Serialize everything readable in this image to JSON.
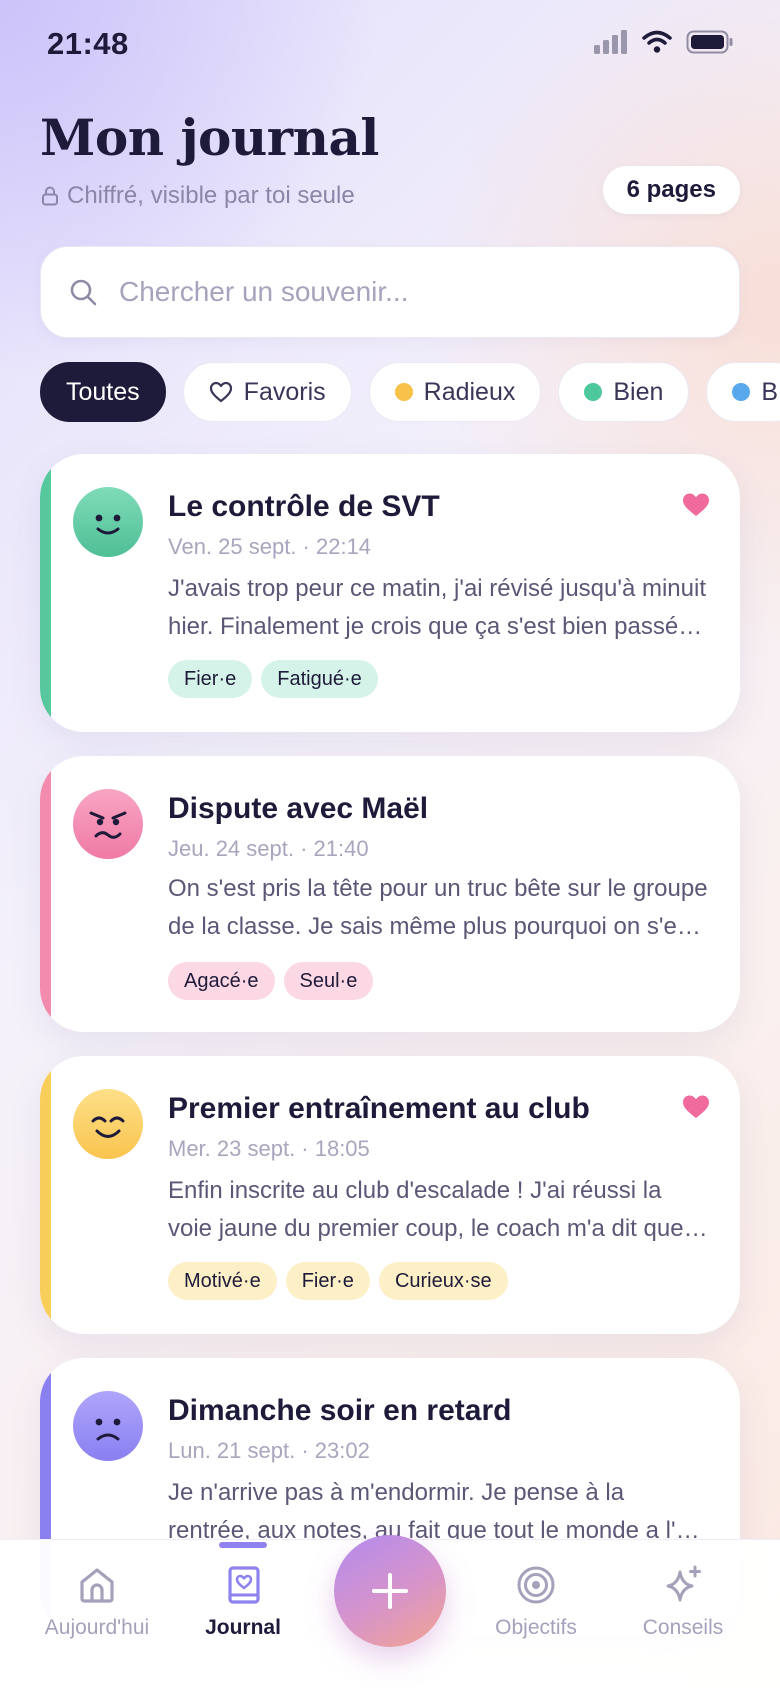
{
  "status_bar": {
    "time": "21:48",
    "icons": [
      "signal-icon",
      "wifi-icon",
      "battery-icon"
    ]
  },
  "header": {
    "title": "Mon journal",
    "subtitle": "Chiffré, visible par toi seule",
    "pages_badge": "6 pages"
  },
  "search": {
    "placeholder": "Chercher un souvenir..."
  },
  "filters": [
    {
      "label": "Toutes",
      "active": true
    },
    {
      "label": "Favoris",
      "icon": "heart-outline-icon"
    },
    {
      "label": "Radieux",
      "color": "#f8c24a"
    },
    {
      "label": "Bien",
      "color": "#4fc79c"
    },
    {
      "label": "B",
      "color": "#5aa8ec"
    }
  ],
  "entries": [
    {
      "title": "Le contrôle de SVT",
      "date": "Ven. 25 sept. · 22:14",
      "text": "J'avais trop peur ce matin, j'ai révisé jusqu'à minuit hier. Finalement je crois que ça s'est bien passé, j'ai su répondre à presque tout.",
      "tags": [
        "Fier·e",
        "Fatigué·e"
      ],
      "mood": "happy-face-icon",
      "accent": "#57c79e",
      "tag_bg": "#d5f3e8",
      "favorite": true
    },
    {
      "title": "Dispute avec Maël",
      "date": "Jeu. 24 sept. · 21:40",
      "text": "On s'est pris la tête pour un truc bête sur le groupe de la classe. Je sais même plus pourquoi on s'est énervés autant.",
      "tags": [
        "Agacé·e",
        "Seul·e"
      ],
      "mood": "angry-face-icon",
      "accent": "#f28bae",
      "tag_bg": "#fcd7e4",
      "favorite": false
    },
    {
      "title": "Premier entraînement au club",
      "date": "Mer. 23 sept. · 18:05",
      "text": "Enfin inscrite au club d'escalade ! J'ai réussi la voie jaune du premier coup, le coach m'a dit que j'avais un bon niveau.",
      "tags": [
        "Motivé·e",
        "Fier·e",
        "Curieux·se"
      ],
      "mood": "joyful-face-icon",
      "accent": "#f9cd5a",
      "tag_bg": "#fdefc6",
      "favorite": true
    },
    {
      "title": "Dimanche soir en retard",
      "date": "Lun. 21 sept. · 23:02",
      "text": "Je n'arrive pas à m'endormir. Je pense à la rentrée, aux notes, au fait que tout le monde a l'air de savoir où il va.",
      "tags": [],
      "mood": "sad-face-icon",
      "accent": "#8b80f0",
      "tag_bg": "#e4e0fd",
      "favorite": false
    }
  ],
  "nav": {
    "items": [
      {
        "label": "Aujourd'hui",
        "icon": "home-icon"
      },
      {
        "label": "Journal",
        "icon": "journal-icon",
        "active": true
      },
      {
        "label": "Objectifs",
        "icon": "target-icon"
      },
      {
        "label": "Conseils",
        "icon": "sparkle-icon"
      }
    ],
    "fab_icon": "plus-icon"
  }
}
